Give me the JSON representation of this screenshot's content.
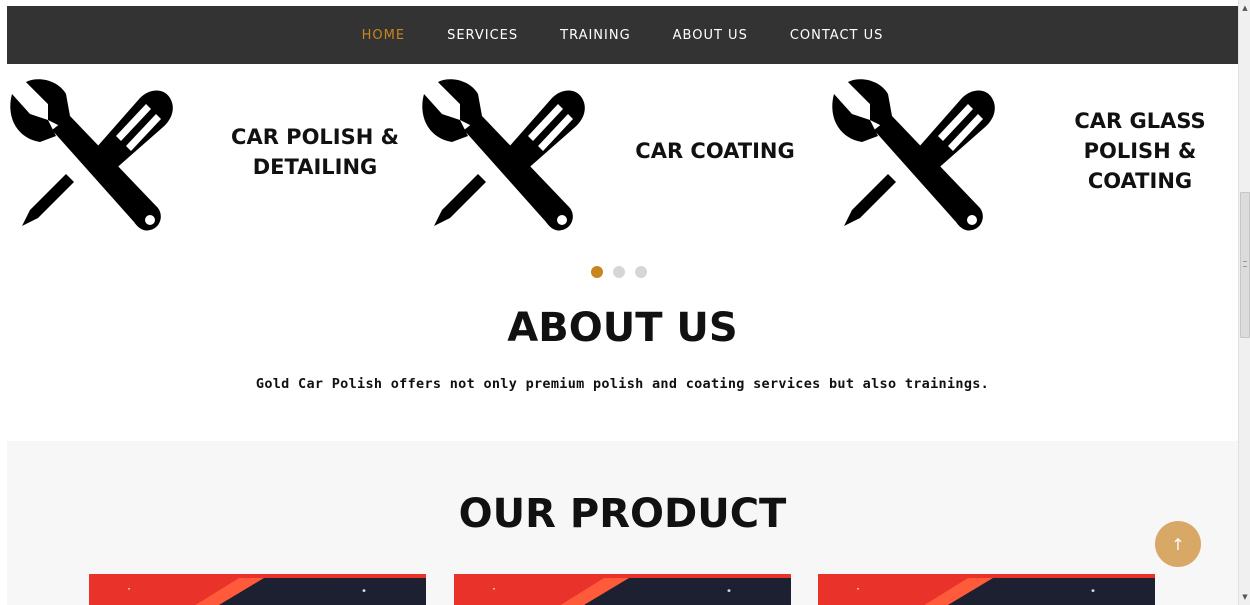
{
  "nav": {
    "items": [
      {
        "label": "HOME",
        "active": true
      },
      {
        "label": "SERVICES",
        "active": false
      },
      {
        "label": "TRAINING",
        "active": false
      },
      {
        "label": "ABOUT US",
        "active": false
      },
      {
        "label": "CONTACT US",
        "active": false
      }
    ]
  },
  "services": {
    "items": [
      {
        "icon": "wrench-screwdriver-icon",
        "title_line1": "CAR POLISH &",
        "title_line2": "DETAILING",
        "title_line3": ""
      },
      {
        "icon": "wrench-screwdriver-icon",
        "title_line1": "CAR COATING",
        "title_line2": "",
        "title_line3": ""
      },
      {
        "icon": "wrench-screwdriver-icon",
        "title_line1": "CAR GLASS",
        "title_line2": "POLISH &",
        "title_line3": "COATING"
      }
    ],
    "slides": 3,
    "active_slide": 1
  },
  "about": {
    "title": "ABOUT US",
    "text": "Gold Car Polish offers not only premium polish and coating services but also trainings."
  },
  "product": {
    "title": "OUR PRODUCT"
  },
  "back_to_top": {
    "icon": "arrow-up-icon",
    "glyph": "↑"
  },
  "colors": {
    "accent": "#c8861e",
    "nav_bg": "#333333",
    "back_to_top_bg": "#d8a867",
    "product_bg": "#f7f7f7"
  }
}
